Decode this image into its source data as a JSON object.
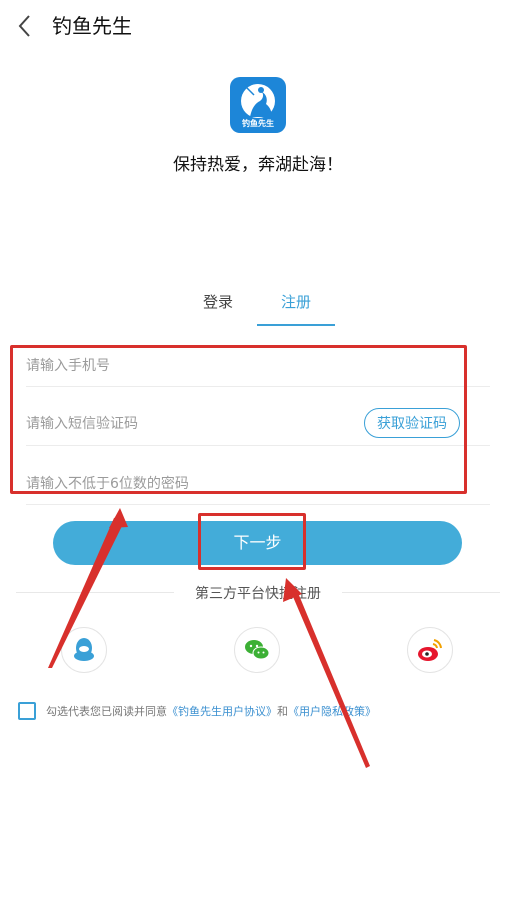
{
  "header": {
    "title": "钓鱼先生"
  },
  "logo": {
    "text": "钓鱼先生"
  },
  "slogan": "保持热爱，奔湖赴海！",
  "tabs": {
    "login": "登录",
    "register": "注册"
  },
  "form": {
    "phone_placeholder": "请输入手机号",
    "sms_placeholder": "请输入短信验证码",
    "password_placeholder": "请输入不低于6位数的密码",
    "get_code_label": "获取验证码"
  },
  "next_label": "下一步",
  "third_party_label": "第三方平台快捷注册",
  "agreement": {
    "prefix": "勾选代表您已阅读并同意",
    "user_agreement": "《钓鱼先生用户协议》",
    "and": "和",
    "privacy_policy": "《用户隐私政策》"
  },
  "colors": {
    "accent": "#3aa0d7",
    "button": "#43acd9",
    "annotation": "#d8302c"
  },
  "social_icons": [
    "qq-icon",
    "wechat-icon",
    "weibo-icon"
  ]
}
